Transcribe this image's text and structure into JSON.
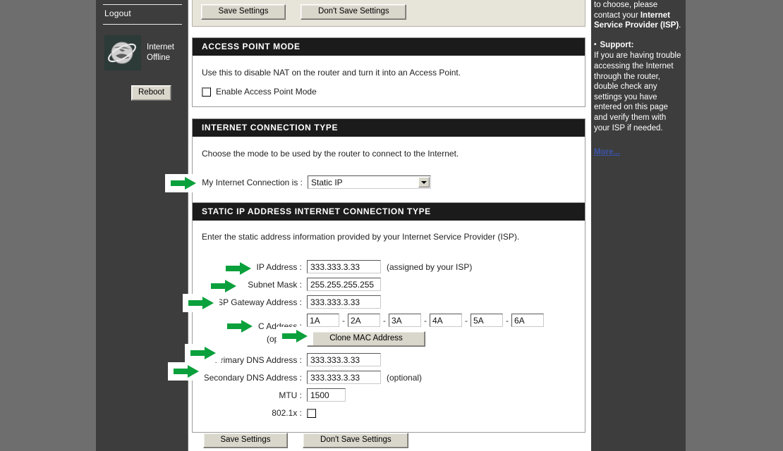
{
  "sidebar": {
    "logout_label": "Logout",
    "status_line1": "Internet",
    "status_line2": "Offline",
    "reboot_label": "Reboot",
    "globe_icon": "globe-icon"
  },
  "toolbar_top": {
    "save_label": "Save Settings",
    "dont_save_label": "Don't Save Settings"
  },
  "toolbar_bottom": {
    "save_label": "Save Settings",
    "dont_save_label": "Don't Save Settings"
  },
  "access_point": {
    "heading": "ACCESS POINT MODE",
    "description": "Use this to disable NAT on the router and turn it into an Access Point.",
    "enable_label": "Enable Access Point Mode",
    "enable_checked": false
  },
  "connection_type": {
    "heading": "INTERNET CONNECTION TYPE",
    "description": "Choose the mode to be used by the router to connect to the Internet.",
    "select_label": "My Internet Connection is :",
    "select_value": "Static IP"
  },
  "static_ip": {
    "heading": "STATIC IP ADDRESS INTERNET CONNECTION TYPE",
    "description": "Enter the static address information provided by your Internet Service Provider (ISP).",
    "ip_label": "IP Address :",
    "ip_value": "333.333.3.33",
    "ip_note": "(assigned by your ISP)",
    "subnet_label": "Subnet Mask :",
    "subnet_value": "255.255.255.255",
    "gateway_label": "ISP Gateway Address :",
    "gateway_value": "333.333.3.33",
    "mac_label": "MAC Address :",
    "mac_octets": [
      "1A",
      "2A",
      "3A",
      "4A",
      "5A",
      "6A"
    ],
    "mac_separator": "-",
    "mac_optional": "(optional)",
    "clone_mac_label": "Clone MAC Address",
    "primary_dns_label": "Primary DNS Address :",
    "primary_dns_value": "333.333.3.33",
    "secondary_dns_label": "Secondary DNS Address :",
    "secondary_dns_value": "333.333.3.33",
    "secondary_dns_note": "(optional)",
    "mtu_label": "MTU :",
    "mtu_value": "1500",
    "dot1x_label": "802.1x :",
    "dot1x_checked": false
  },
  "help": {
    "para1_pre": "to choose, please contact your ",
    "para1_bold": "Internet Service Provider (ISP)",
    "para1_post": ".",
    "support_label": "Support:",
    "support_text": "If you are having trouble accessing the Internet through the router, double check any settings you have entered on this page and verify them with your ISP if needed.",
    "more_label": "More..."
  },
  "colors": {
    "accent_arrow": "#0aa03c",
    "section_header_bg": "#1b1b1b",
    "sidebar_bg": "#3d3d3d",
    "page_bg": "#6e6e6e",
    "link": "#3c55a8"
  }
}
